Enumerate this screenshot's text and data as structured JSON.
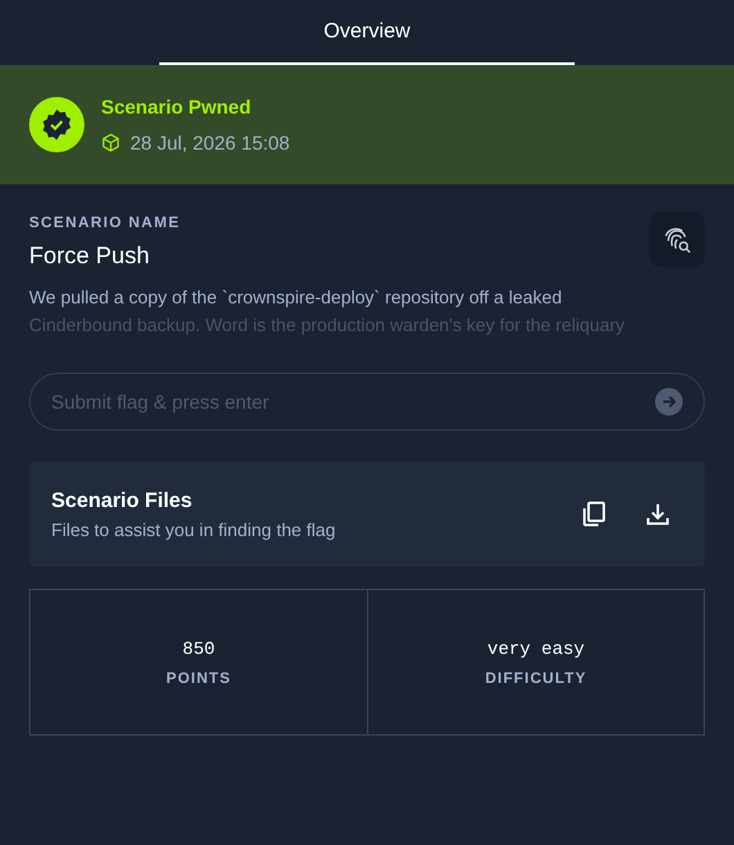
{
  "tabs": [
    {
      "label": "Overview",
      "selected": true
    }
  ],
  "status_banner": {
    "title": "Scenario Pwned",
    "timestamp": "28 Jul, 2026 15:08"
  },
  "scenario": {
    "label": "SCENARIO NAME",
    "name": "Force Push",
    "description_lines": [
      "We pulled a copy of the `crownspire-deploy` repository off a leaked",
      "Cinderbound backup. Word is the production warden's key for the reliquary"
    ]
  },
  "flag_field": {
    "placeholder": "Submit flag & press enter"
  },
  "files": {
    "title": "Scenario Files",
    "subtitle": "Files to assist you in finding the flag"
  },
  "stats": [
    {
      "value": "850",
      "label": "POINTS"
    },
    {
      "value": "very easy",
      "label": "DIFFICULTY"
    }
  ]
}
